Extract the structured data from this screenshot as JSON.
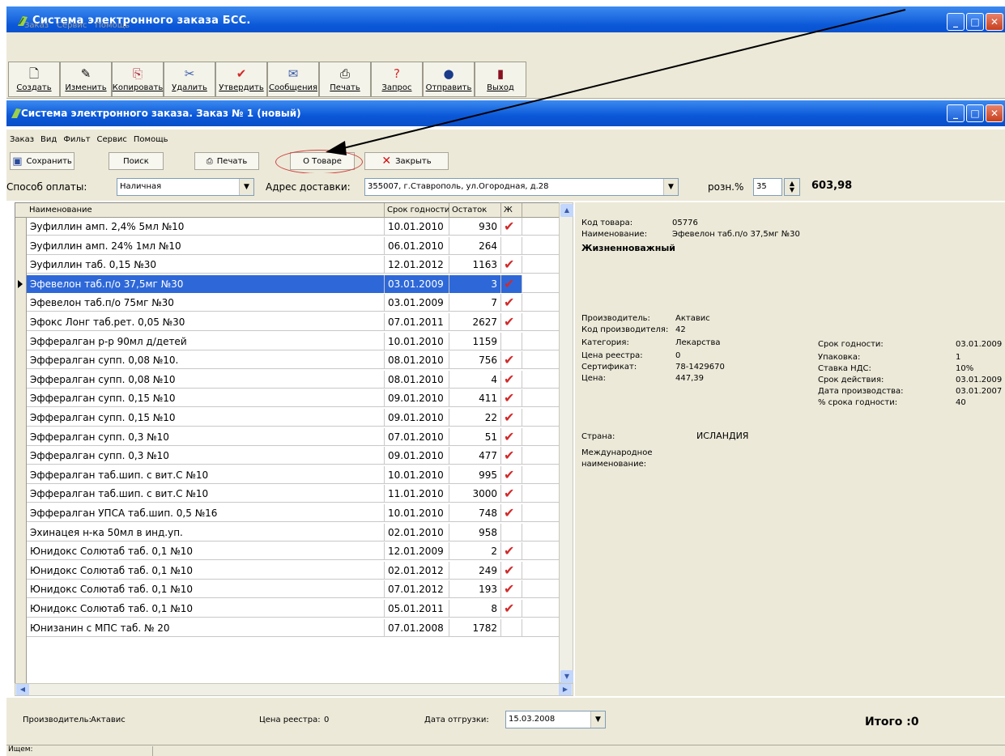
{
  "outer_window": {
    "title": "Система электронного заказа БСС.",
    "menu": [
      "Заказ",
      "Сервис",
      "Помощь"
    ],
    "toolbar": [
      {
        "label": "Создать",
        "icon": "new-document-icon",
        "glyph": "🗋"
      },
      {
        "label": "Изменить",
        "icon": "edit-icon",
        "glyph": "✎"
      },
      {
        "label": "Копировать",
        "icon": "copy-icon",
        "glyph": "⎘"
      },
      {
        "label": "Удалить",
        "icon": "delete-icon",
        "glyph": "✂"
      },
      {
        "label": "Утвердить",
        "icon": "checkmark-icon",
        "glyph": "✔"
      },
      {
        "label": "Сообщения",
        "icon": "envelope-icon",
        "glyph": "✉"
      },
      {
        "label": "Печать",
        "icon": "printer-icon",
        "glyph": "⎙"
      },
      {
        "label": "Запрос",
        "icon": "query-icon",
        "glyph": "?"
      },
      {
        "label": "Отправить",
        "icon": "globe-icon",
        "glyph": "●"
      },
      {
        "label": "Выход",
        "icon": "exit-door-icon",
        "glyph": "▮"
      }
    ]
  },
  "inner_window": {
    "title": "Система электронного заказа. Заказ № 1 (новый)",
    "menu": [
      "Заказ",
      "Вид",
      "Фильт",
      "Сервис",
      "Помощь"
    ],
    "toolbar": {
      "save": "Сохранить",
      "search": "Поиск",
      "print": "Печать",
      "about": "О Товаре",
      "close": "Закрыть"
    }
  },
  "filters": {
    "payment_label": "Способ оплаты:",
    "payment_value": "Наличная",
    "address_label": "Адрес доставки:",
    "address_value": "355007, г.Ставрополь, ул.Огородная, д.28",
    "markup_label": "розн.%",
    "markup_value": "35",
    "total_value": "603,98"
  },
  "grid": {
    "headers": [
      "Наименование",
      "Срок годности",
      "Остаток",
      "Ж"
    ],
    "selected_index": 3,
    "rows": [
      {
        "name": "Эуфиллин амп. 2,4% 5мл №10",
        "expiry": "10.01.2010",
        "stock": "930",
        "vital": true
      },
      {
        "name": "Эуфиллин амп. 24% 1мл №10",
        "expiry": "06.01.2010",
        "stock": "264",
        "vital": false
      },
      {
        "name": "Эуфиллин таб. 0,15 №30",
        "expiry": "12.01.2012",
        "stock": "1163",
        "vital": true
      },
      {
        "name": "Эфевелон таб.п/о 37,5мг №30",
        "expiry": "03.01.2009",
        "stock": "3",
        "vital": true
      },
      {
        "name": "Эфевелон таб.п/о 75мг №30",
        "expiry": "03.01.2009",
        "stock": "7",
        "vital": true
      },
      {
        "name": "Эфокс Лонг таб.рет. 0,05 №30",
        "expiry": "07.01.2011",
        "stock": "2627",
        "vital": true
      },
      {
        "name": "Эффералган р-р 90мл д/детей",
        "expiry": "10.01.2010",
        "stock": "1159",
        "vital": false
      },
      {
        "name": "Эффералган супп. 0,08 №10.",
        "expiry": "08.01.2010",
        "stock": "756",
        "vital": true
      },
      {
        "name": "Эффералган супп. 0,08 №10",
        "expiry": "08.01.2010",
        "stock": "4",
        "vital": true
      },
      {
        "name": "Эффералган супп. 0,15 №10",
        "expiry": "09.01.2010",
        "stock": "411",
        "vital": true
      },
      {
        "name": "Эффералган супп. 0,15 №10",
        "expiry": "09.01.2010",
        "stock": "22",
        "vital": true
      },
      {
        "name": "Эффералган супп. 0,3 №10",
        "expiry": "07.01.2010",
        "stock": "51",
        "vital": true
      },
      {
        "name": "Эффералган супп. 0,3 №10",
        "expiry": "09.01.2010",
        "stock": "477",
        "vital": true
      },
      {
        "name": "Эффералган таб.шип. с вит.С №10",
        "expiry": "10.01.2010",
        "stock": "995",
        "vital": true
      },
      {
        "name": "Эффералган таб.шип. с вит.С №10",
        "expiry": "11.01.2010",
        "stock": "3000",
        "vital": true
      },
      {
        "name": "Эффералган УПСА таб.шип. 0,5 №16",
        "expiry": "10.01.2010",
        "stock": "748",
        "vital": true
      },
      {
        "name": "Эхинацея н-ка 50мл в инд.уп.",
        "expiry": "02.01.2010",
        "stock": "958",
        "vital": false
      },
      {
        "name": "Юнидокс Солютаб таб. 0,1 №10",
        "expiry": "12.01.2009",
        "stock": "2",
        "vital": true
      },
      {
        "name": "Юнидокс Солютаб таб. 0,1 №10",
        "expiry": "02.01.2012",
        "stock": "249",
        "vital": true
      },
      {
        "name": "Юнидокс Солютаб таб. 0,1 №10",
        "expiry": "07.01.2012",
        "stock": "193",
        "vital": true
      },
      {
        "name": "Юнидокс Солютаб таб. 0,1 №10",
        "expiry": "05.01.2011",
        "stock": "8",
        "vital": true
      },
      {
        "name": "Юнизанин с МПС таб. № 20",
        "expiry": "07.01.2008",
        "stock": "1782",
        "vital": false
      }
    ],
    "check_glyph": "✔"
  },
  "detail": {
    "code_label": "Код товара:",
    "code_value": "05776",
    "name_label": "Наименование:",
    "name_value": "Эфевелон таб.п/о 37,5мг №30",
    "vital_text": "Жизненноважный",
    "producer_label": "Производитель:",
    "producer_value": "Актавис",
    "producer_code_label": "Код производителя:",
    "producer_code_value": "42",
    "category_label": "Категория:",
    "category_value": "Лекарства",
    "registry_price_label": "Цена реестра:",
    "registry_price_value": "0",
    "certificate_label": "Сертификат:",
    "certificate_value": "78-1429670",
    "price_label": "Цена:",
    "price_value": "447,39",
    "expiry_label": "Срок годности:",
    "expiry_value": "03.01.2009",
    "package_label": "Упаковка:",
    "package_value": "1",
    "vat_label": "Ставка НДС:",
    "vat_value": "10%",
    "valid_label": "Срок действия:",
    "valid_value": "03.01.2009",
    "made_label": "Дата производства:",
    "made_value": "03.01.2007",
    "shelf_pct_label": "% срока годности:",
    "shelf_pct_value": "40",
    "country_label": "Страна:",
    "country_value": "ИСЛАНДИЯ",
    "inn_label_1": "Международное",
    "inn_label_2": "наименование:"
  },
  "bottom": {
    "producer_label": "Производитель:",
    "producer_value": "Актавис",
    "registry_label": "Цена реестра:",
    "registry_value": "0",
    "ship_label": "Дата отгрузки:",
    "ship_value": "15.03.2008",
    "total": "Итого :0"
  },
  "status": {
    "text": "Ищем:"
  }
}
